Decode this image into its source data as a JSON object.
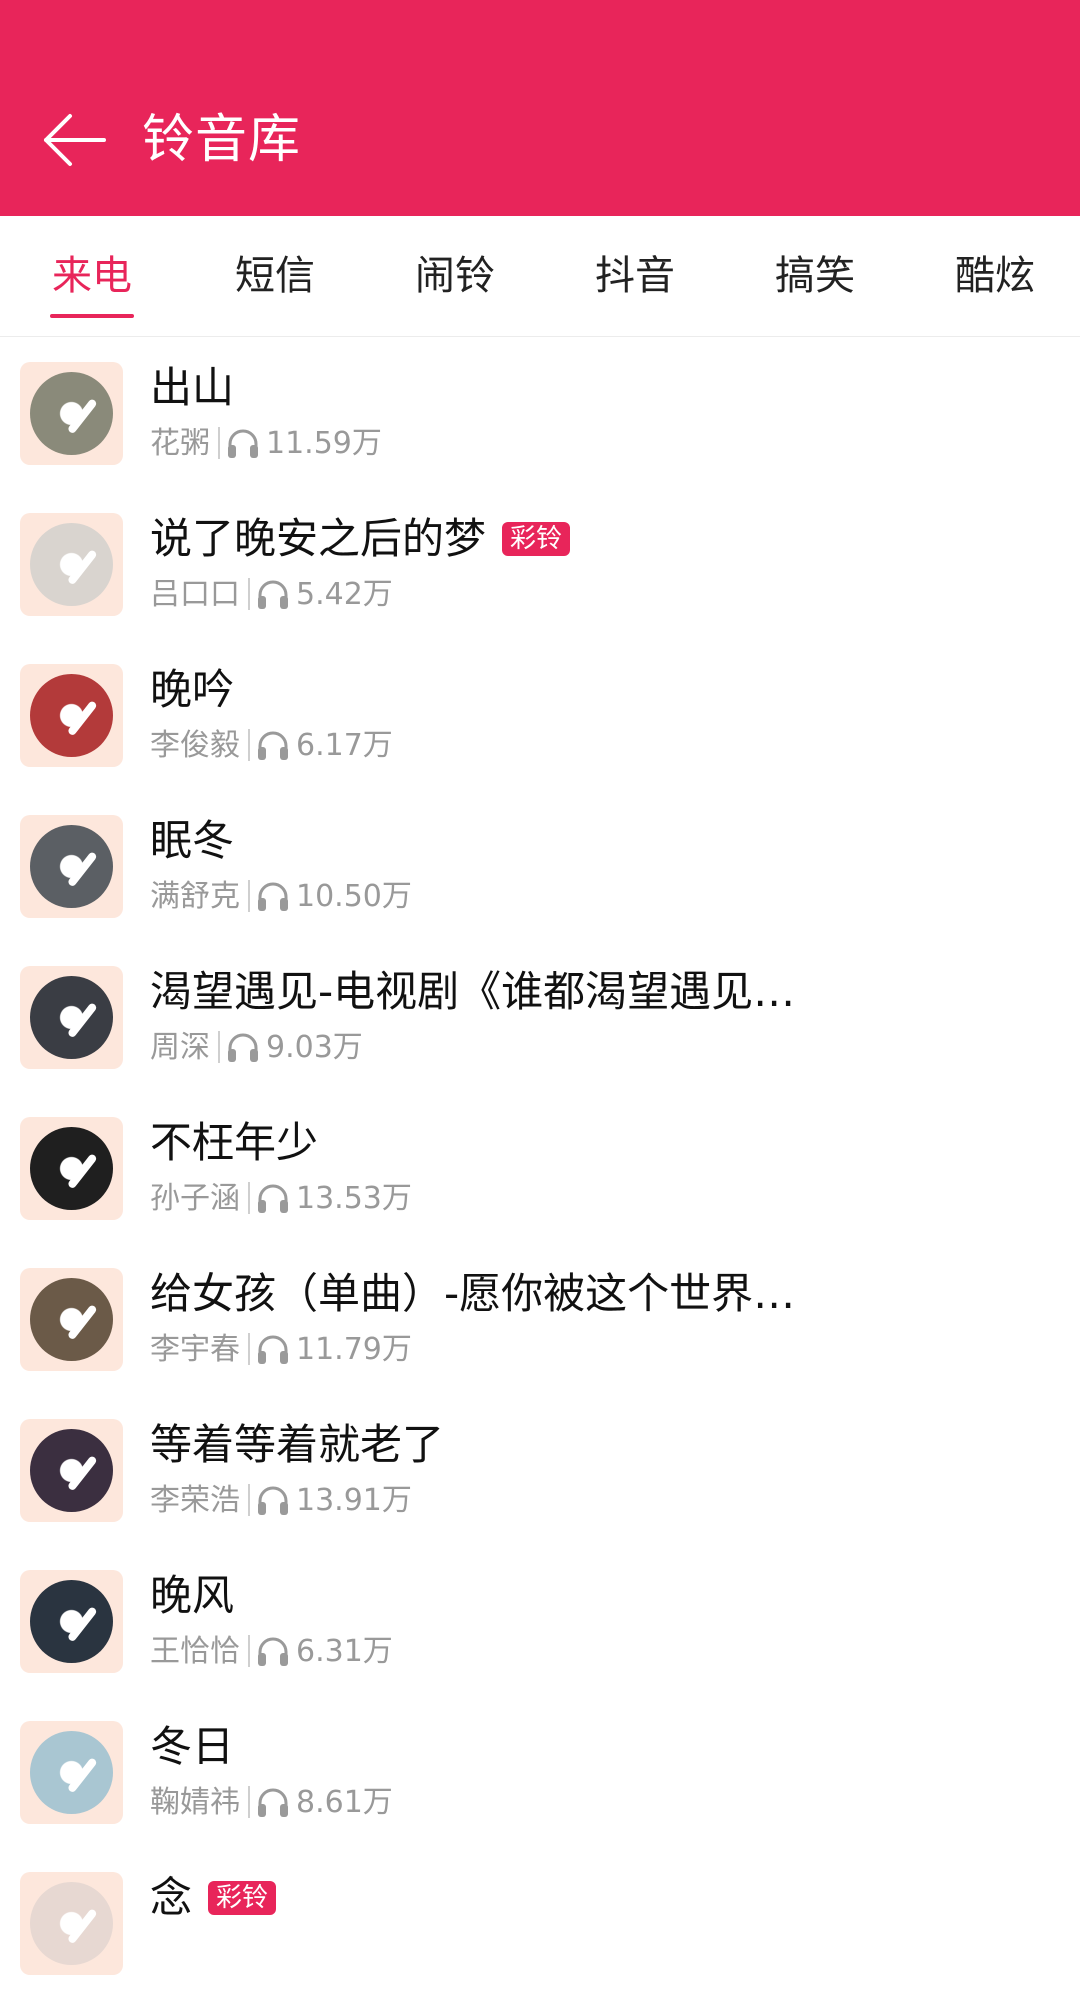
{
  "header": {
    "title": "铃音库",
    "back_icon": "back-arrow-icon"
  },
  "tabs": [
    {
      "label": "来电",
      "active": true
    },
    {
      "label": "短信",
      "active": false
    },
    {
      "label": "闹铃",
      "active": false
    },
    {
      "label": "抖音",
      "active": false
    },
    {
      "label": "搞笑",
      "active": false
    },
    {
      "label": "酷炫",
      "active": false
    }
  ],
  "colors": {
    "accent": "#e8255a",
    "title_text": "#111111",
    "meta_text": "#999999",
    "cover_bg": "#fde7dc"
  },
  "songs": [
    {
      "title": "出山",
      "badge": "",
      "artist": "花粥",
      "plays": "11.59万",
      "disc_color": "#8a8a7a"
    },
    {
      "title": "说了晚安之后的梦",
      "badge": "彩铃",
      "artist": "吕口口",
      "plays": "5.42万",
      "disc_color": "#d9d4cf"
    },
    {
      "title": "晚吟",
      "badge": "",
      "artist": "李俊毅",
      "plays": "6.17万",
      "disc_color": "#b33a3a"
    },
    {
      "title": "眠冬",
      "badge": "",
      "artist": "满舒克",
      "plays": "10.50万",
      "disc_color": "#5b5f64"
    },
    {
      "title": "渴望遇见-电视剧《谁都渴望遇见…",
      "badge": "",
      "artist": "周深",
      "plays": "9.03万",
      "disc_color": "#3a3d44"
    },
    {
      "title": "不枉年少",
      "badge": "",
      "artist": "孙子涵",
      "plays": "13.53万",
      "disc_color": "#1f1f1f"
    },
    {
      "title": "给女孩（单曲）-愿你被这个世界…",
      "badge": "",
      "artist": "李宇春",
      "plays": "11.79万",
      "disc_color": "#6b5a48"
    },
    {
      "title": "等着等着就老了",
      "badge": "",
      "artist": "李荣浩",
      "plays": "13.91万",
      "disc_color": "#3b2f40"
    },
    {
      "title": "晚风",
      "badge": "",
      "artist": "王恰恰",
      "plays": "6.31万",
      "disc_color": "#2a3440"
    },
    {
      "title": "冬日",
      "badge": "",
      "artist": "鞠婧祎",
      "plays": "8.61万",
      "disc_color": "#a9c6d2"
    },
    {
      "title": "念",
      "badge": "彩铃",
      "artist": "",
      "plays": "",
      "disc_color": "#e7d8d2"
    }
  ]
}
